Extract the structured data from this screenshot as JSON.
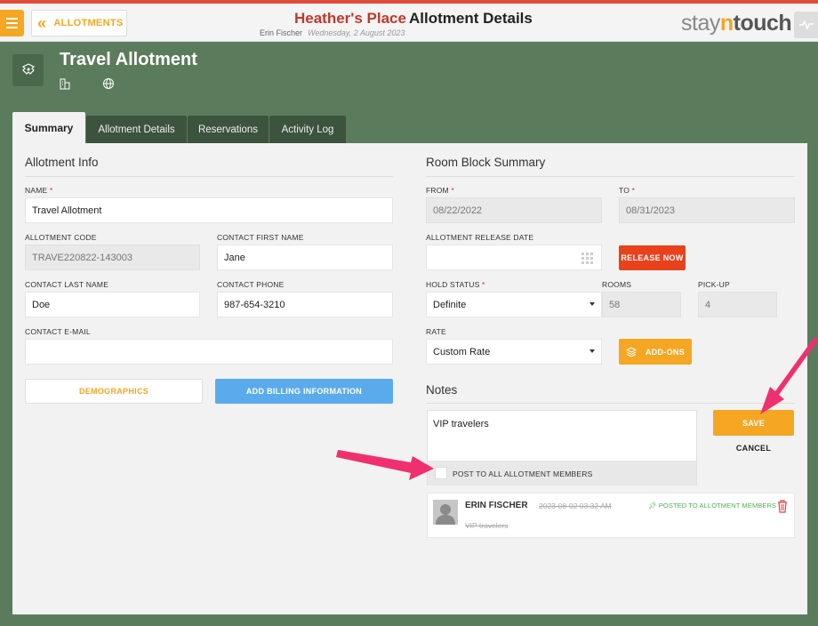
{
  "header": {
    "back_label": "ALLOTMENTS",
    "hotel_name": "Heather's Place",
    "page_title": "Allotment Details",
    "user_name": "Erin Fischer",
    "date": "Wednesday, 2 August 2023",
    "brand_pre": "stay",
    "brand_n": "n",
    "brand_post": "touch"
  },
  "allotment": {
    "title": "Travel Allotment"
  },
  "tabs": [
    {
      "label": "Summary",
      "active": true
    },
    {
      "label": "Allotment Details",
      "active": false
    },
    {
      "label": "Reservations",
      "active": false
    },
    {
      "label": "Activity Log",
      "active": false
    }
  ],
  "info": {
    "heading": "Allotment Info",
    "name_label": "NAME",
    "name_value": "Travel Allotment",
    "code_label": "ALLOTMENT CODE",
    "code_value": "TRAVE220822-143003",
    "first_label": "CONTACT FIRST NAME",
    "first_value": "Jane",
    "last_label": "CONTACT LAST NAME",
    "last_value": "Doe",
    "phone_label": "CONTACT PHONE",
    "phone_value": "987-654-3210",
    "email_label": "CONTACT E-MAIL",
    "email_value": "",
    "demographics_label": "DEMOGRAPHICS",
    "billing_label": "ADD BILLING INFORMATION"
  },
  "room_block": {
    "heading": "Room Block Summary",
    "from_label": "FROM",
    "from_value": "08/22/2022",
    "to_label": "TO",
    "to_value": "08/31/2023",
    "release_label": "ALLOTMENT RELEASE DATE",
    "release_value": "",
    "release_now_label": "RELEASE NOW",
    "hold_label": "HOLD STATUS",
    "hold_value": "Definite",
    "rooms_label": "ROOMS",
    "rooms_value": "58",
    "pickup_label": "PICK-UP",
    "pickup_value": "4",
    "rate_label": "RATE",
    "rate_value": "Custom Rate",
    "addons_label": "ADD-ONS"
  },
  "notes": {
    "heading": "Notes",
    "text": "VIP travelers",
    "post_all_label": "POST TO ALL ALLOTMENT MEMBERS",
    "save_label": "SAVE",
    "cancel_label": "CANCEL",
    "entry": {
      "author": "ERIN FISCHER",
      "time": "2023-08-02 03:32 AM",
      "posted": "POSTED TO ALLOTMENT MEMBERS",
      "body": "VIP travelers"
    }
  },
  "colors": {
    "accent": "#f5a623",
    "release": "#e8411b",
    "billing": "#5aabec",
    "background": "#5b7b5d",
    "arrow": "#f0306e"
  }
}
